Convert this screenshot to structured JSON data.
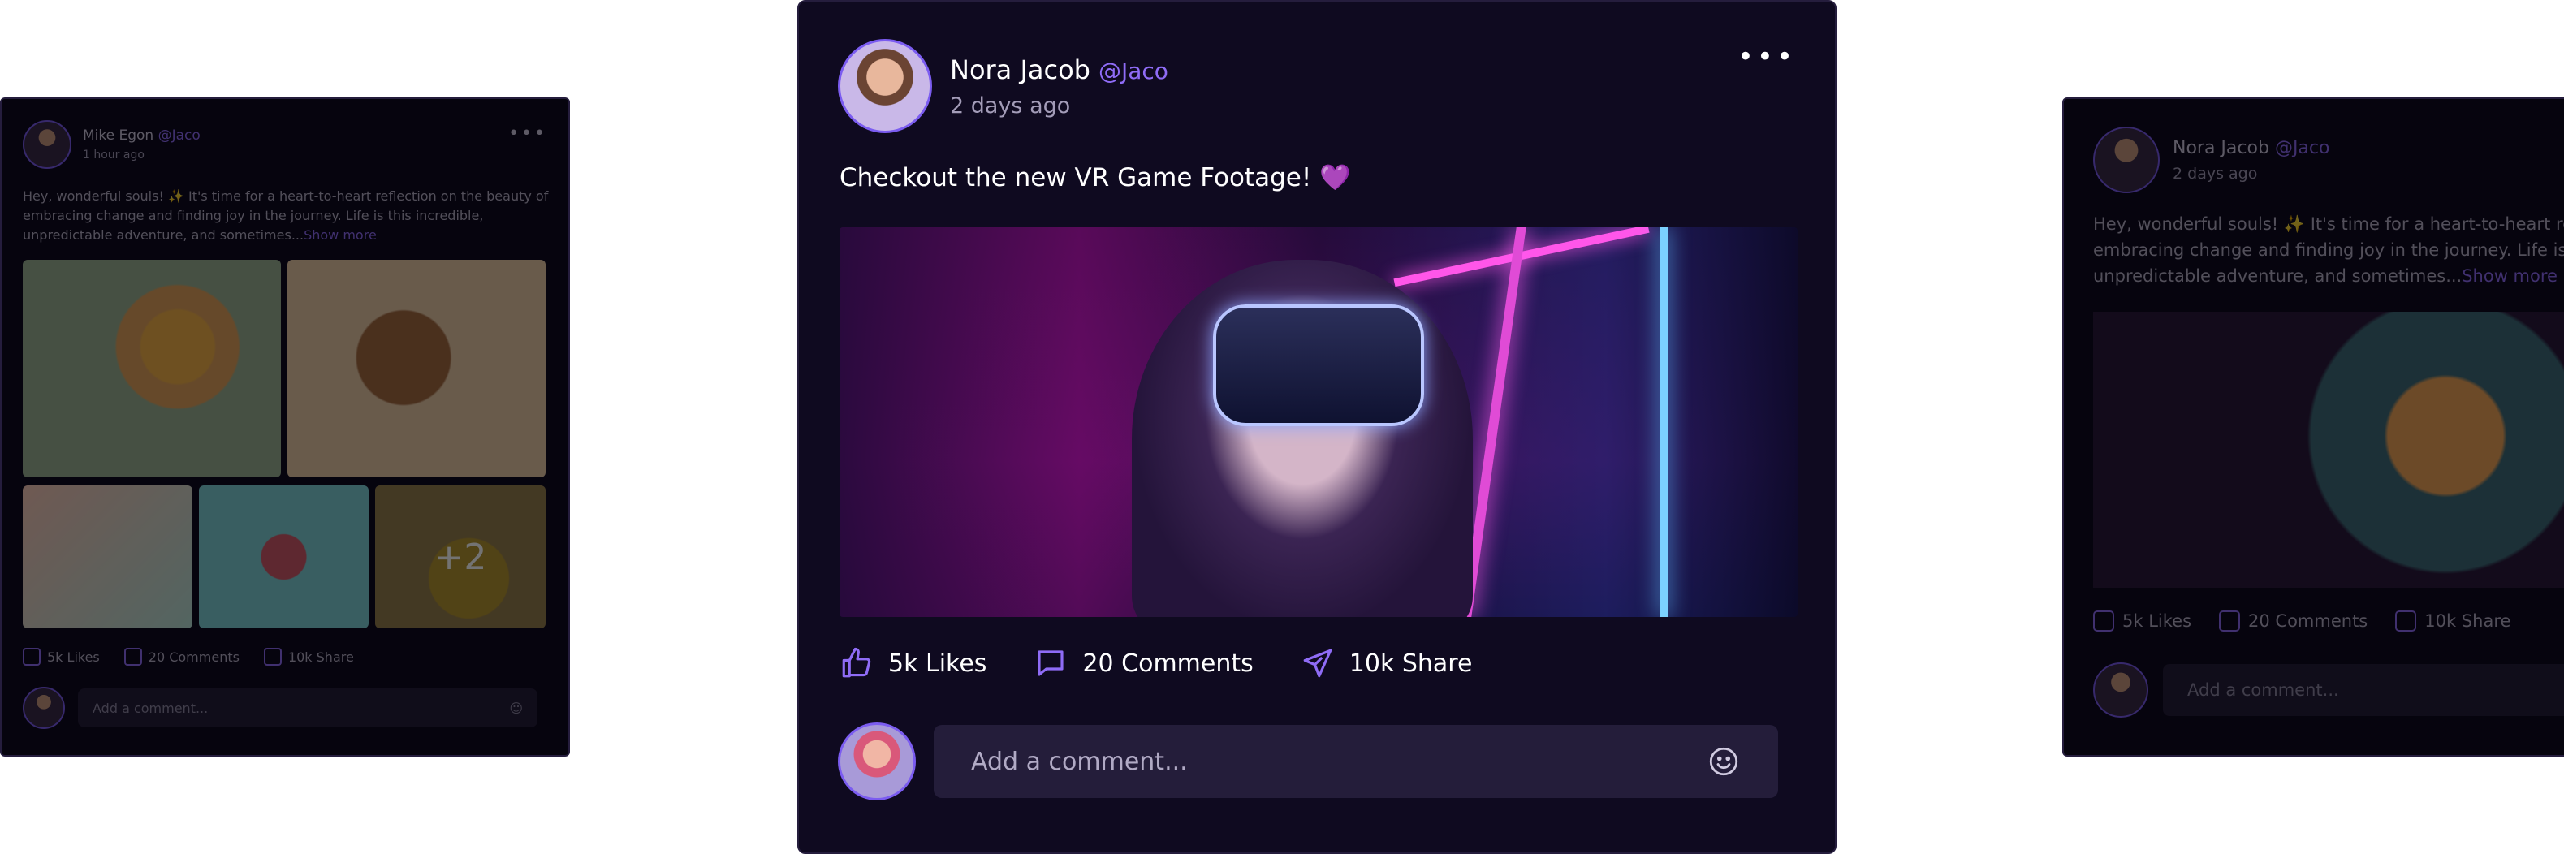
{
  "left_post": {
    "author": "Mike Egon",
    "handle": "@Jaco",
    "time": "1 hour ago",
    "menu_icon": "more-horizontal-icon",
    "text": "Hey, wonderful souls! ✨ It's time for a heart-to-heart reflection on the beauty of embracing change and finding joy in the journey. Life is this incredible, unpredictable adventure, and sometimes...",
    "show_more": "Show more",
    "more_count": "+2",
    "likes": "5k Likes",
    "comments": "20 Comments",
    "share": "10k Share",
    "comment_placeholder": "Add a comment...",
    "emoji_icon": "smile-icon"
  },
  "main_post": {
    "author": "Nora Jacob",
    "handle": "@Jaco",
    "time": "2 days ago",
    "menu_icon": "more-horizontal-icon",
    "caption": "Checkout the new VR Game Footage!",
    "caption_emoji": "💜",
    "likes": "5k Likes",
    "comments": "20 Comments",
    "share": "10k Share",
    "comment_placeholder": "Add a comment...",
    "emoji_icon": "smile-icon"
  },
  "right_post": {
    "author": "Nora Jacob",
    "handle": "@Jaco",
    "time": "2 days ago",
    "text_line1": "Hey, wonderful souls! ✨ It's time for a heart-to-heart re",
    "text_line2": "embracing change and finding joy in the journey. Life is",
    "text_line3": "unpredictable adventure, and sometimes...",
    "show_more": "Show more",
    "likes": "5k Likes",
    "comments": "20 Comments",
    "share": "10k Share",
    "comment_placeholder": "Add a comment..."
  },
  "colors": {
    "card_bg": "#0f0a20",
    "accent": "#8f6cf6",
    "input_bg": "#241d3a"
  }
}
